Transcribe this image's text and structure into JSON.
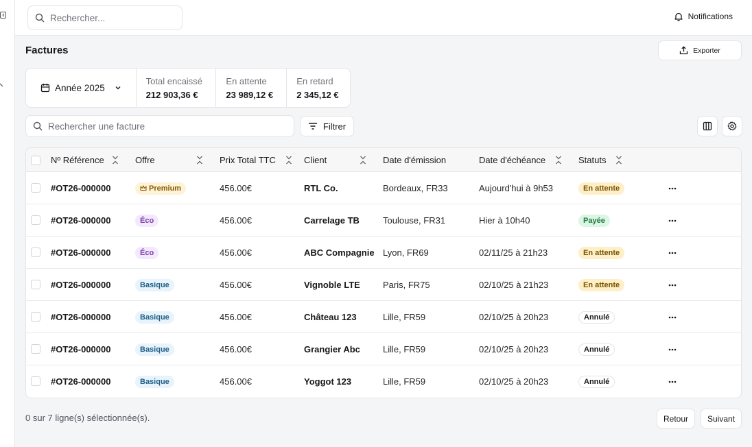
{
  "topbar": {
    "search_placeholder": "Rechercher...",
    "notifications_label": "Notifications"
  },
  "page": {
    "title": "Factures",
    "export_label": "Exporter"
  },
  "stats": {
    "year_label": "Année 2025",
    "items": [
      {
        "label": "Total encaissé",
        "value": "212 903,36 €"
      },
      {
        "label": "En attente",
        "value": "23 989,12 €"
      },
      {
        "label": "En retard",
        "value": "2 345,12 €"
      }
    ]
  },
  "toolbar": {
    "search_placeholder": "Rechercher une facture",
    "filter_label": "Filtrer"
  },
  "table": {
    "columns": {
      "reference": "Nº Référence",
      "offer": "Offre",
      "price": "Prix Total TTC",
      "client": "Client",
      "issue_date": "Date d'émission",
      "due_date": "Date d'échéance",
      "status": "Statuts"
    },
    "rows": [
      {
        "reference": "#OT26-000000",
        "offer": "Premium",
        "offer_type": "premium",
        "price": "456.00€",
        "client": "RTL Co.",
        "location": "Bordeaux, FR33",
        "due": "Aujourd'hui à 9h53",
        "status": "En attente",
        "status_type": "pending"
      },
      {
        "reference": "#OT26-000000",
        "offer": "Éco",
        "offer_type": "eco",
        "price": "456.00€",
        "client": "Carrelage TB",
        "location": "Toulouse, FR31",
        "due": "Hier à 10h40",
        "status": "Payée",
        "status_type": "paid"
      },
      {
        "reference": "#OT26-000000",
        "offer": "Éco",
        "offer_type": "eco",
        "price": "456.00€",
        "client": "ABC Compagnie",
        "location": "Lyon, FR69",
        "due": "02/11/25 à 21h23",
        "status": "En attente",
        "status_type": "pending"
      },
      {
        "reference": "#OT26-000000",
        "offer": "Basique",
        "offer_type": "basic",
        "price": "456.00€",
        "client": "Vignoble LTE",
        "location": "Paris, FR75",
        "due": "02/10/25 à 21h23",
        "status": "En attente",
        "status_type": "pending"
      },
      {
        "reference": "#OT26-000000",
        "offer": "Basique",
        "offer_type": "basic",
        "price": "456.00€",
        "client": "Château 123",
        "location": "Lille, FR59",
        "due": "02/10/25 à 20h23",
        "status": "Annulé",
        "status_type": "cancelled"
      },
      {
        "reference": "#OT26-000000",
        "offer": "Basique",
        "offer_type": "basic",
        "price": "456.00€",
        "client": "Grangier Abc",
        "location": "Lille, FR59",
        "due": "02/10/25 à 20h23",
        "status": "Annulé",
        "status_type": "cancelled"
      },
      {
        "reference": "#OT26-000000",
        "offer": "Basique",
        "offer_type": "basic",
        "price": "456.00€",
        "client": "Yoggot 123",
        "location": "Lille, FR59",
        "due": "02/10/25 à 20h23",
        "status": "Annulé",
        "status_type": "cancelled"
      }
    ]
  },
  "footer": {
    "selection_text": "0 sur 7 ligne(s) sélectionnée(s).",
    "prev_label": "Retour",
    "next_label": "Suivant"
  },
  "colors": {
    "premium_bg": "#fdf3d8",
    "premium_fg": "#8a5a00",
    "eco_bg": "#f3e8fd",
    "eco_fg": "#7b3fa8",
    "basic_bg": "#e8f3fb",
    "basic_fg": "#1f5f86",
    "pending_bg": "#fdefc8",
    "pending_fg": "#7a5200",
    "paid_bg": "#dcf5e4",
    "paid_fg": "#1c7a3e",
    "cancelled_bg": "#ffffff",
    "cancelled_fg": "#18181b"
  }
}
